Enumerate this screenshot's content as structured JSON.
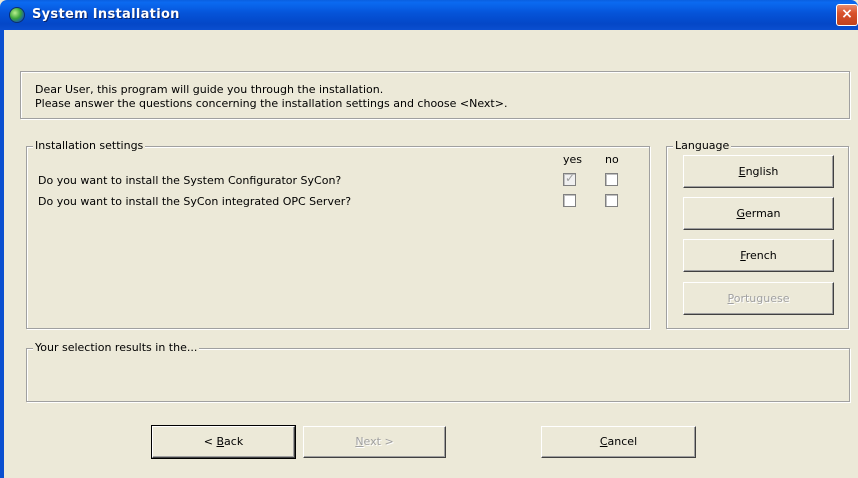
{
  "window": {
    "title": "System Installation",
    "close_label": "×"
  },
  "intro": {
    "line1": "Dear User, this program will guide you through the installation.",
    "line2": "Please answer the questions concerning the installation settings and choose <Next>."
  },
  "settings": {
    "legend": "Installation settings",
    "col_yes": "yes",
    "col_no": "no",
    "questions": [
      {
        "text": "Do you want to install the System Configurator SyCon?",
        "yes_checked": true,
        "yes_disabled": true,
        "no_checked": false
      },
      {
        "text": "Do you want to install the SyCon integrated OPC Server?",
        "yes_checked": false,
        "yes_disabled": false,
        "no_checked": false
      }
    ]
  },
  "language": {
    "legend": "Language",
    "buttons": [
      {
        "mnemonic": "E",
        "rest": "nglish",
        "enabled": true
      },
      {
        "mnemonic": "G",
        "rest": "erman",
        "enabled": true
      },
      {
        "mnemonic": "F",
        "rest": "rench",
        "enabled": true
      },
      {
        "mnemonic": "P",
        "rest": "ortuguese",
        "enabled": false
      }
    ]
  },
  "result": {
    "legend": "Your selection results in the..."
  },
  "nav": {
    "back_prefix": "< ",
    "back_mnemonic": "B",
    "back_rest": "ack",
    "next_mnemonic": "N",
    "next_rest": "ext >",
    "cancel_mnemonic": "C",
    "cancel_rest": "ancel"
  }
}
